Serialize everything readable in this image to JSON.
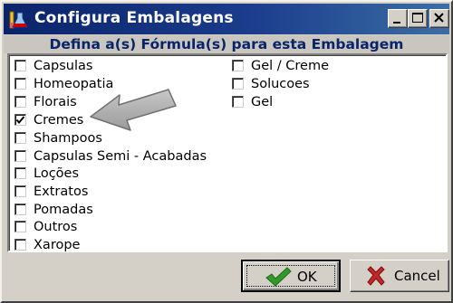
{
  "window": {
    "title": "Configura Embalagens",
    "controls": {
      "minimize": "minimize",
      "maximize": "maximize",
      "close": "close"
    }
  },
  "subtitle": "Defina a(s) Fórmula(s) para esta Embalagem",
  "formulas_col1": [
    {
      "label": "Capsulas",
      "checked": false
    },
    {
      "label": "Homeopatia",
      "checked": false
    },
    {
      "label": "Florais",
      "checked": false
    },
    {
      "label": "Cremes",
      "checked": true
    },
    {
      "label": "Shampoos",
      "checked": false
    },
    {
      "label": "Capsulas Semi - Acabadas",
      "checked": false
    },
    {
      "label": "Loções",
      "checked": false
    },
    {
      "label": "Extratos",
      "checked": false
    },
    {
      "label": "Pomadas",
      "checked": false
    },
    {
      "label": "Outros",
      "checked": false
    },
    {
      "label": "Xarope",
      "checked": false
    }
  ],
  "formulas_col2": [
    {
      "label": "Gel / Creme",
      "checked": false
    },
    {
      "label": "Solucoes",
      "checked": false
    },
    {
      "label": "Gel",
      "checked": false
    }
  ],
  "buttons": {
    "ok_label": "OK",
    "cancel_label": "Cancel"
  },
  "icons": {
    "app": "flask-icon",
    "ok": "checkmark-icon",
    "cancel": "x-mark-icon",
    "annotation": "arrow-pointer-icon"
  },
  "colors": {
    "titlebar": "#0a246a",
    "subtitle_text": "#0a246a",
    "ok_check": "#2f9a2a",
    "cancel_x": "#c0282a",
    "dialog_face": "#d4d0c8"
  }
}
